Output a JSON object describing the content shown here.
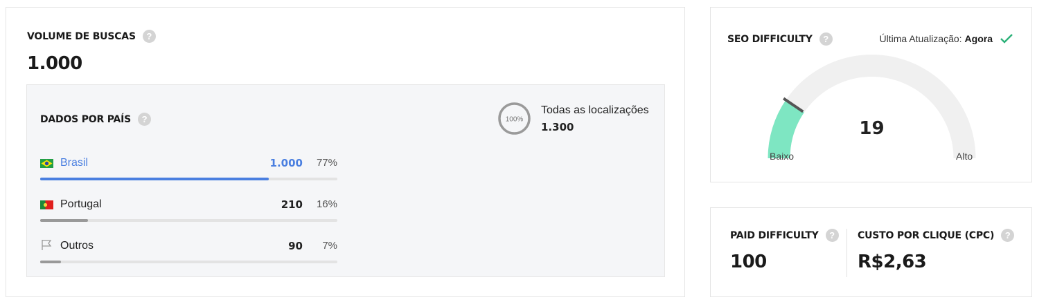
{
  "volume": {
    "title": "VOLUME DE BUSCAS",
    "value": "1.000",
    "help_icon": "help-icon"
  },
  "countries": {
    "title": "DADOS POR PAÍS",
    "all_locations_label": "Todas as localizações",
    "all_locations_value": "1.300",
    "all_locations_pct": "100%",
    "rows": [
      {
        "name": "Brasil",
        "value": "1.000",
        "pct": "77%",
        "share": 0.77,
        "color": "#4a7fe0",
        "highlight": true,
        "icon": "brazil-flag-icon"
      },
      {
        "name": "Portugal",
        "value": "210",
        "pct": "16%",
        "share": 0.16,
        "color": "#999999",
        "highlight": false,
        "icon": "portugal-flag-icon"
      },
      {
        "name": "Outros",
        "value": "90",
        "pct": "7%",
        "share": 0.07,
        "color": "#999999",
        "highlight": false,
        "icon": "flag-outline-icon"
      }
    ]
  },
  "seo": {
    "title": "SEO DIFFICULTY",
    "update_label": "Última Atualização:",
    "update_value": "Agora",
    "score": "19",
    "score_fraction": 0.19,
    "low_label": "Baixo",
    "high_label": "Alto",
    "gauge_color": "#7ee6c2",
    "check_color": "#2db27a"
  },
  "paid": {
    "title": "PAID DIFFICULTY",
    "value": "100"
  },
  "cpc": {
    "title": "CUSTO POR CLIQUE (CPC)",
    "value": "R$2,63"
  }
}
